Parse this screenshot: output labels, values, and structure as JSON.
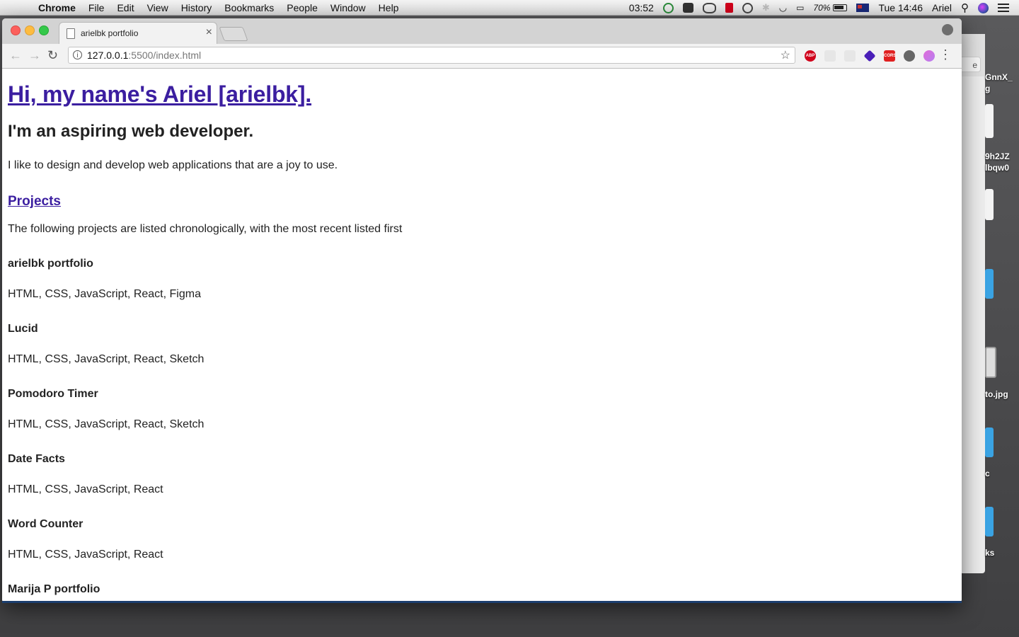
{
  "menubar": {
    "app_name": "Chrome",
    "menus": [
      "File",
      "Edit",
      "View",
      "History",
      "Bookmarks",
      "People",
      "Window",
      "Help"
    ],
    "timer": "03:52",
    "battery": "70%",
    "clock": "Tue 14:46",
    "user": "Ariel"
  },
  "browser": {
    "tab_title": "arielbk portfolio",
    "url_host": "127.0.0.1",
    "url_rest": ":5500/index.html",
    "bg_window_button": "e"
  },
  "desktop": {
    "labels": [
      "GnnX_",
      "g",
      "9h2JZ",
      "lbqw0",
      "to.jpg",
      "c",
      "ks"
    ]
  },
  "page": {
    "heading": "Hi, my name's Ariel [arielbk].",
    "subheading": "I'm an aspiring web developer.",
    "intro": "I like to design and develop web applications that are a joy to use.",
    "projects_link": "Projects",
    "projects_intro": "The following projects are listed chronologically, with the most recent listed first",
    "projects": [
      {
        "name": "arielbk portfolio",
        "tech": "HTML, CSS, JavaScript, React, Figma"
      },
      {
        "name": "Lucid",
        "tech": "HTML, CSS, JavaScript, React, Sketch"
      },
      {
        "name": "Pomodoro Timer",
        "tech": "HTML, CSS, JavaScript, React, Sketch"
      },
      {
        "name": "Date Facts",
        "tech": "HTML, CSS, JavaScript, React"
      },
      {
        "name": "Word Counter",
        "tech": "HTML, CSS, JavaScript, React"
      },
      {
        "name": "Marija P portfolio",
        "tech": ""
      }
    ]
  },
  "colors": {
    "link": "#3b1ea0",
    "text": "#222222"
  },
  "icons": [
    "apple-icon",
    "timer-icon",
    "evernote-icon",
    "cloud-icon",
    "lock-icon",
    "do-not-disturb-icon",
    "bluetooth-icon",
    "wifi-icon",
    "airplay-icon",
    "battery-icon",
    "flag-icon",
    "spotlight-icon",
    "siri-icon",
    "notification-center-icon"
  ]
}
